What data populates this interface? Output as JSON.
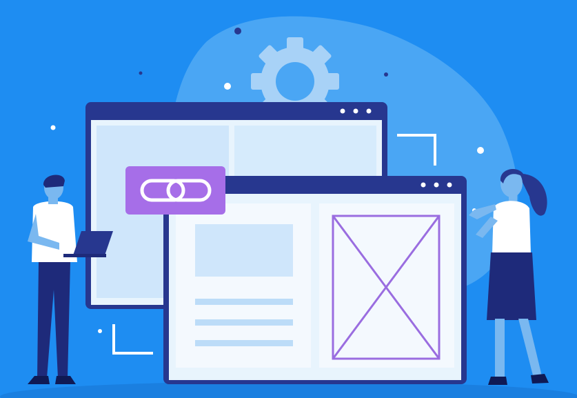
{
  "illustration": {
    "subject": "link-building-web-pages",
    "colors": {
      "background": "#1e8df2",
      "background_blob": "#4aa6f4",
      "window_frame": "#27378f",
      "window_body": "#e8f4fd",
      "panel_light": "#cfe6fb",
      "accent_purple": "#a66ee8",
      "wireframe_purple": "#9a6de0",
      "navy": "#1e2a7a",
      "skin": "#7ab8f0",
      "white": "#ffffff"
    },
    "icons": [
      "gear-icon",
      "chain-link-icon",
      "image-placeholder-icon",
      "laptop-icon"
    ]
  }
}
